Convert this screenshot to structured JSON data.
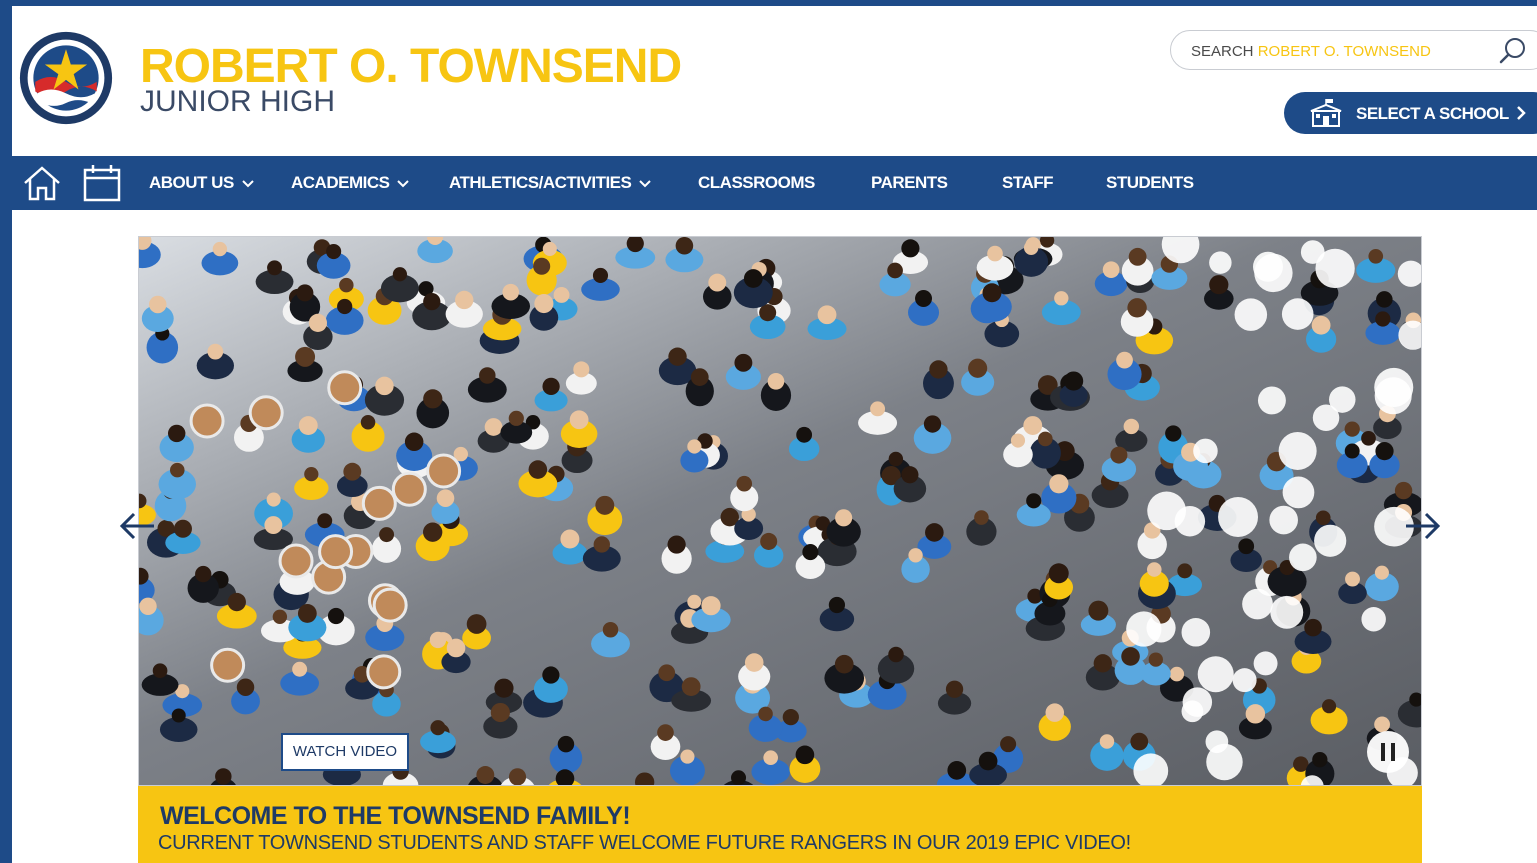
{
  "header": {
    "school_name": "ROBERT O. TOWNSEND",
    "school_subtitle": "JUNIOR HIGH",
    "logo_icon": "school-seal-logo-icon",
    "search": {
      "prefix": "SEARCH",
      "highlight": "ROBERT O. TOWNSEND",
      "icon": "search-icon"
    },
    "select_school": {
      "label": "SELECT A SCHOOL",
      "icon": "school-building-icon"
    }
  },
  "nav": {
    "icons": [
      "home-icon",
      "calendar-icon"
    ],
    "items": [
      {
        "label": "ABOUT US",
        "dropdown": true
      },
      {
        "label": "ACADEMICS",
        "dropdown": true
      },
      {
        "label": "ATHLETICS/ACTIVITIES",
        "dropdown": true
      },
      {
        "label": "CLASSROOMS",
        "dropdown": false
      },
      {
        "label": "PARENTS",
        "dropdown": false
      },
      {
        "label": "STAFF",
        "dropdown": false
      },
      {
        "label": "STUDENTS",
        "dropdown": false
      }
    ]
  },
  "hero": {
    "watch_video_label": "WATCH VIDEO",
    "caption_title": "WELCOME TO THE TOWNSEND FAMILY!",
    "caption_subtitle": "CURRENT TOWNSEND STUDENTS AND STAFF WELCOME FUTURE RANGERS IN OUR 2019 EPIC VIDEO!",
    "controls": [
      "arrow-left-icon",
      "arrow-right-icon",
      "pause-icon"
    ]
  },
  "colors": {
    "brand_blue": "#1e4b88",
    "brand_yellow": "#f7c512",
    "text_navy": "#1e3a66"
  }
}
